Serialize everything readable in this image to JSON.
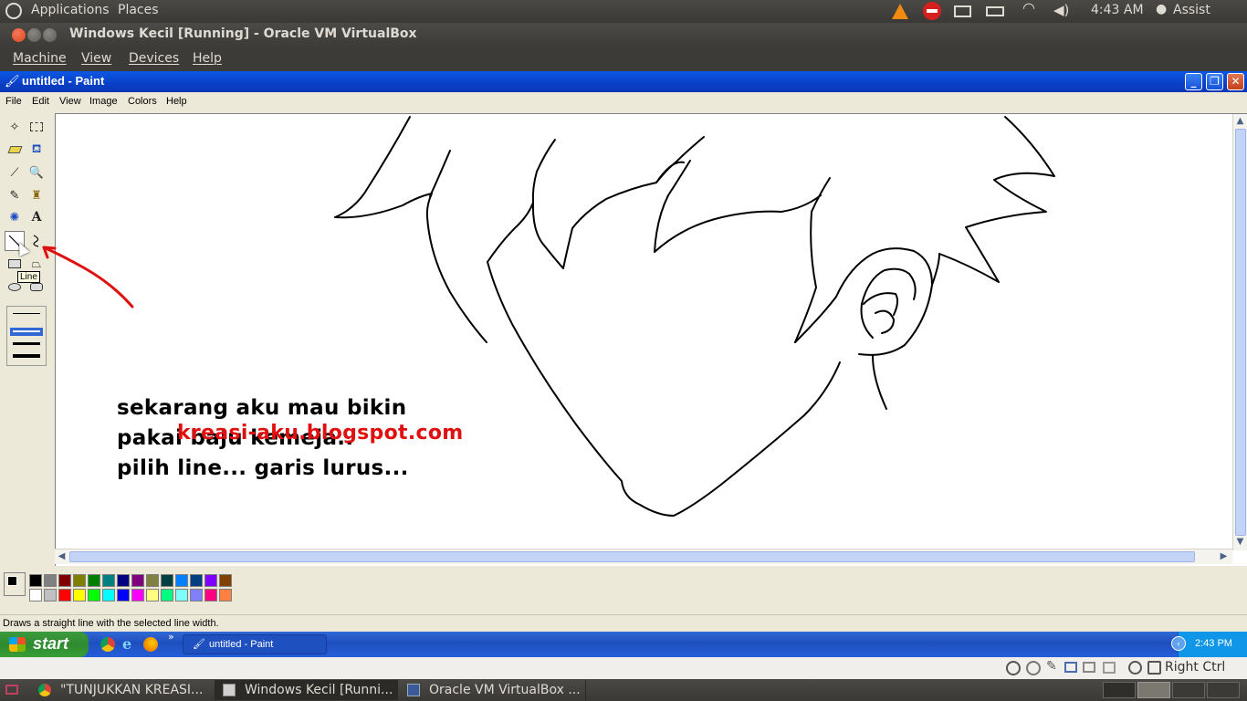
{
  "top_panel": {
    "applications": "Applications",
    "places": "Places",
    "time": "4:43 AM",
    "user": "Assist"
  },
  "vbox": {
    "title": "Windows Kecil [Running] - Oracle VM VirtualBox",
    "menu": [
      "Machine",
      "View",
      "Devices",
      "Help"
    ],
    "host_key": "Right Ctrl"
  },
  "paint": {
    "title": "untitled - Paint",
    "menu": [
      "File",
      "Edit",
      "View",
      "Image",
      "Colors",
      "Help"
    ],
    "tooltip": "Line",
    "status": "Draws a straight line with the selected line width.",
    "annotation_lines": [
      "sekarang aku mau bikin",
      "pakai baju kemeja..",
      "pilih line... garis lurus..."
    ],
    "blog_url": "kreasi-aku.blogspot.com",
    "palette_row1": [
      "#000000",
      "#808080",
      "#800000",
      "#808000",
      "#008000",
      "#008080",
      "#000080",
      "#800080",
      "#808040",
      "#004040",
      "#0080ff",
      "#004080",
      "#8000ff",
      "#804000"
    ],
    "palette_row2": [
      "#ffffff",
      "#c0c0c0",
      "#ff0000",
      "#ffff00",
      "#00ff00",
      "#00ffff",
      "#0000ff",
      "#ff00ff",
      "#ffff80",
      "#00ff80",
      "#80ffff",
      "#8080ff",
      "#ff0080",
      "#ff8040"
    ],
    "accent_annotation": "#e01010"
  },
  "xp_taskbar": {
    "start": "start",
    "task": "untitled - Paint",
    "clock": "2:43 PM"
  },
  "bottom_panel": {
    "tasks": [
      "\"TUNJUKKAN KREASI...",
      "Windows Kecil [Runni...",
      "Oracle VM VirtualBox ..."
    ]
  }
}
